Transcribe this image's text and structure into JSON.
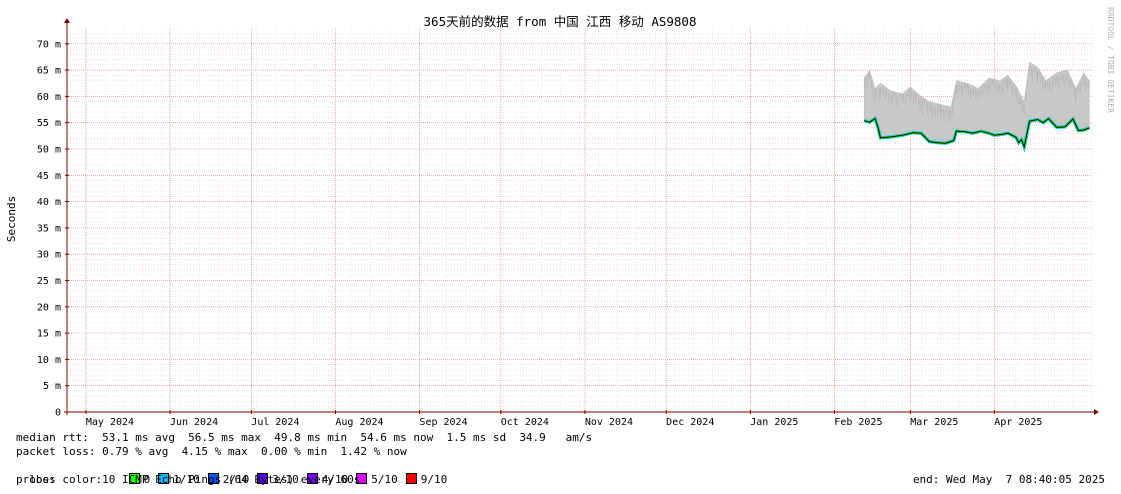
{
  "chart_data": {
    "type": "area",
    "title": "365天前的数据 from 中国 江西 移动 AS9808",
    "ylabel": "Seconds",
    "ylim": [
      0,
      73
    ],
    "yticks": [
      {
        "v": 0,
        "label": "0"
      },
      {
        "v": 5,
        "label": "5 m"
      },
      {
        "v": 10,
        "label": "10 m"
      },
      {
        "v": 15,
        "label": "15 m"
      },
      {
        "v": 20,
        "label": "20 m"
      },
      {
        "v": 25,
        "label": "25 m"
      },
      {
        "v": 30,
        "label": "30 m"
      },
      {
        "v": 35,
        "label": "35 m"
      },
      {
        "v": 40,
        "label": "40 m"
      },
      {
        "v": 45,
        "label": "45 m"
      },
      {
        "v": 50,
        "label": "50 m"
      },
      {
        "v": 55,
        "label": "55 m"
      },
      {
        "v": 60,
        "label": "60 m"
      },
      {
        "v": 65,
        "label": "65 m"
      },
      {
        "v": 70,
        "label": "70 m"
      }
    ],
    "x_start": "2024-04-24",
    "x_end": "2025-05-07",
    "month_labels": [
      {
        "date": "2024-05-01",
        "label": "May 2024"
      },
      {
        "date": "2024-06-01",
        "label": "Jun 2024"
      },
      {
        "date": "2024-07-01",
        "label": "Jul 2024"
      },
      {
        "date": "2024-08-01",
        "label": "Aug 2024"
      },
      {
        "date": "2024-09-01",
        "label": "Sep 2024"
      },
      {
        "date": "2024-10-01",
        "label": "Oct 2024"
      },
      {
        "date": "2024-11-01",
        "label": "Nov 2024"
      },
      {
        "date": "2024-12-01",
        "label": "Dec 2024"
      },
      {
        "date": "2025-01-01",
        "label": "Jan 2025"
      },
      {
        "date": "2025-02-01",
        "label": "Feb 2025"
      },
      {
        "date": "2025-03-01",
        "label": "Mar 2025"
      },
      {
        "date": "2025-04-01",
        "label": "Apr 2025"
      }
    ],
    "series": [
      {
        "role": "median",
        "x": [
          "2025-02-12",
          "2025-02-14",
          "2025-02-16",
          "2025-02-17",
          "2025-02-18",
          "2025-02-22",
          "2025-02-26",
          "2025-03-02",
          "2025-03-05",
          "2025-03-08",
          "2025-03-11",
          "2025-03-14",
          "2025-03-17",
          "2025-03-18",
          "2025-03-21",
          "2025-03-24",
          "2025-03-27",
          "2025-03-30",
          "2025-04-01",
          "2025-04-04",
          "2025-04-06",
          "2025-04-09",
          "2025-04-10",
          "2025-04-11",
          "2025-04-12",
          "2025-04-14",
          "2025-04-17",
          "2025-04-19",
          "2025-04-21",
          "2025-04-24",
          "2025-04-27",
          "2025-04-30",
          "2025-05-02",
          "2025-05-04",
          "2025-05-06"
        ],
        "y": [
          55.4,
          55.1,
          55.8,
          54.2,
          52.1,
          52.3,
          52.6,
          53.1,
          53.0,
          51.4,
          51.2,
          51.1,
          51.6,
          53.4,
          53.3,
          53.0,
          53.4,
          53.0,
          52.6,
          52.8,
          53.0,
          52.2,
          51.2,
          51.8,
          50.4,
          55.3,
          55.6,
          55.0,
          55.8,
          54.1,
          54.2,
          55.7,
          53.5,
          53.6,
          54.0
        ]
      },
      {
        "role": "smoke_max",
        "x": [
          "2025-02-12",
          "2025-02-14",
          "2025-02-16",
          "2025-02-18",
          "2025-02-22",
          "2025-02-26",
          "2025-03-01",
          "2025-03-05",
          "2025-03-08",
          "2025-03-12",
          "2025-03-16",
          "2025-03-18",
          "2025-03-22",
          "2025-03-26",
          "2025-03-30",
          "2025-04-03",
          "2025-04-06",
          "2025-04-09",
          "2025-04-12",
          "2025-04-14",
          "2025-04-17",
          "2025-04-20",
          "2025-04-24",
          "2025-04-28",
          "2025-05-01",
          "2025-05-04",
          "2025-05-06"
        ],
        "y": [
          63.5,
          65.0,
          61.5,
          62.5,
          61.0,
          60.5,
          61.8,
          60.0,
          59.0,
          58.5,
          58.0,
          63.0,
          62.5,
          61.5,
          63.5,
          63.0,
          64.0,
          62.0,
          59.0,
          66.5,
          65.5,
          63.0,
          64.5,
          65.0,
          61.5,
          64.5,
          63.0
        ]
      }
    ],
    "stats": {
      "median_rtt": "median rtt:  53.1 ms avg  56.5 ms max  49.8 ms min  54.6 ms now  1.5 ms sd  34.9   am/s",
      "packet_loss": "packet loss: 0.79 % avg  4.15 % max  0.00 % min  1.42 % now",
      "loss_color_label": "loss color:",
      "probe": "probe:       10 ICMP Echo Pings (64 Bytes) every 60s",
      "end": "end: Wed May  7 08:40:05 2025"
    },
    "loss_colors": [
      {
        "label": "0",
        "color": "#26ff00"
      },
      {
        "label": "1/10",
        "color": "#00b8ff"
      },
      {
        "label": "2/10",
        "color": "#0059ff"
      },
      {
        "label": "3/10",
        "color": "#5e00ff"
      },
      {
        "label": "4/10",
        "color": "#7e00ff"
      },
      {
        "label": "5/10",
        "color": "#dd00ff"
      },
      {
        "label": "9/10",
        "color": "#ff0000"
      }
    ],
    "watermark": "RRDTOOL / TOBI OETIKER",
    "colors": {
      "smoke": "#c8c8c8",
      "median": "#000000",
      "grid": "#dd9999",
      "axis": "#800000"
    }
  }
}
